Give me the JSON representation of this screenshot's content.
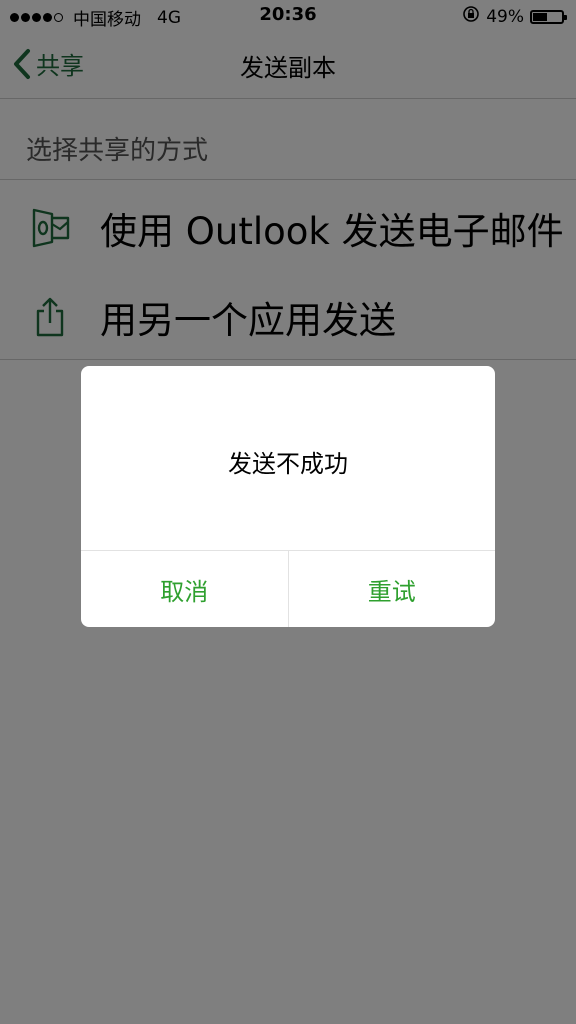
{
  "status_bar": {
    "carrier": "中国移动",
    "network": "4G",
    "time": "20:36",
    "battery_percent_label": "49%",
    "battery_level": 0.49,
    "signal_bars_filled": 4,
    "signal_bars_total": 5,
    "icons": [
      "signal-dots-icon",
      "rotation-lock-icon",
      "battery-icon"
    ]
  },
  "nav": {
    "back_label": "共享",
    "back_icon": "chevron-left-icon",
    "title": "发送副本"
  },
  "section": {
    "label": "选择共享的方式"
  },
  "options": [
    {
      "icon": "outlook-icon",
      "label": "使用 Outlook 发送电子邮件"
    },
    {
      "icon": "share-icon",
      "label": "用另一个应用发送"
    }
  ],
  "dialog": {
    "message": "发送不成功",
    "cancel_label": "取消",
    "retry_label": "重试"
  },
  "colors": {
    "accent_dark_green": "#1f6b3c",
    "dialog_button_green": "#2fa02f",
    "overlay": "rgba(0,0,0,0.5)"
  }
}
